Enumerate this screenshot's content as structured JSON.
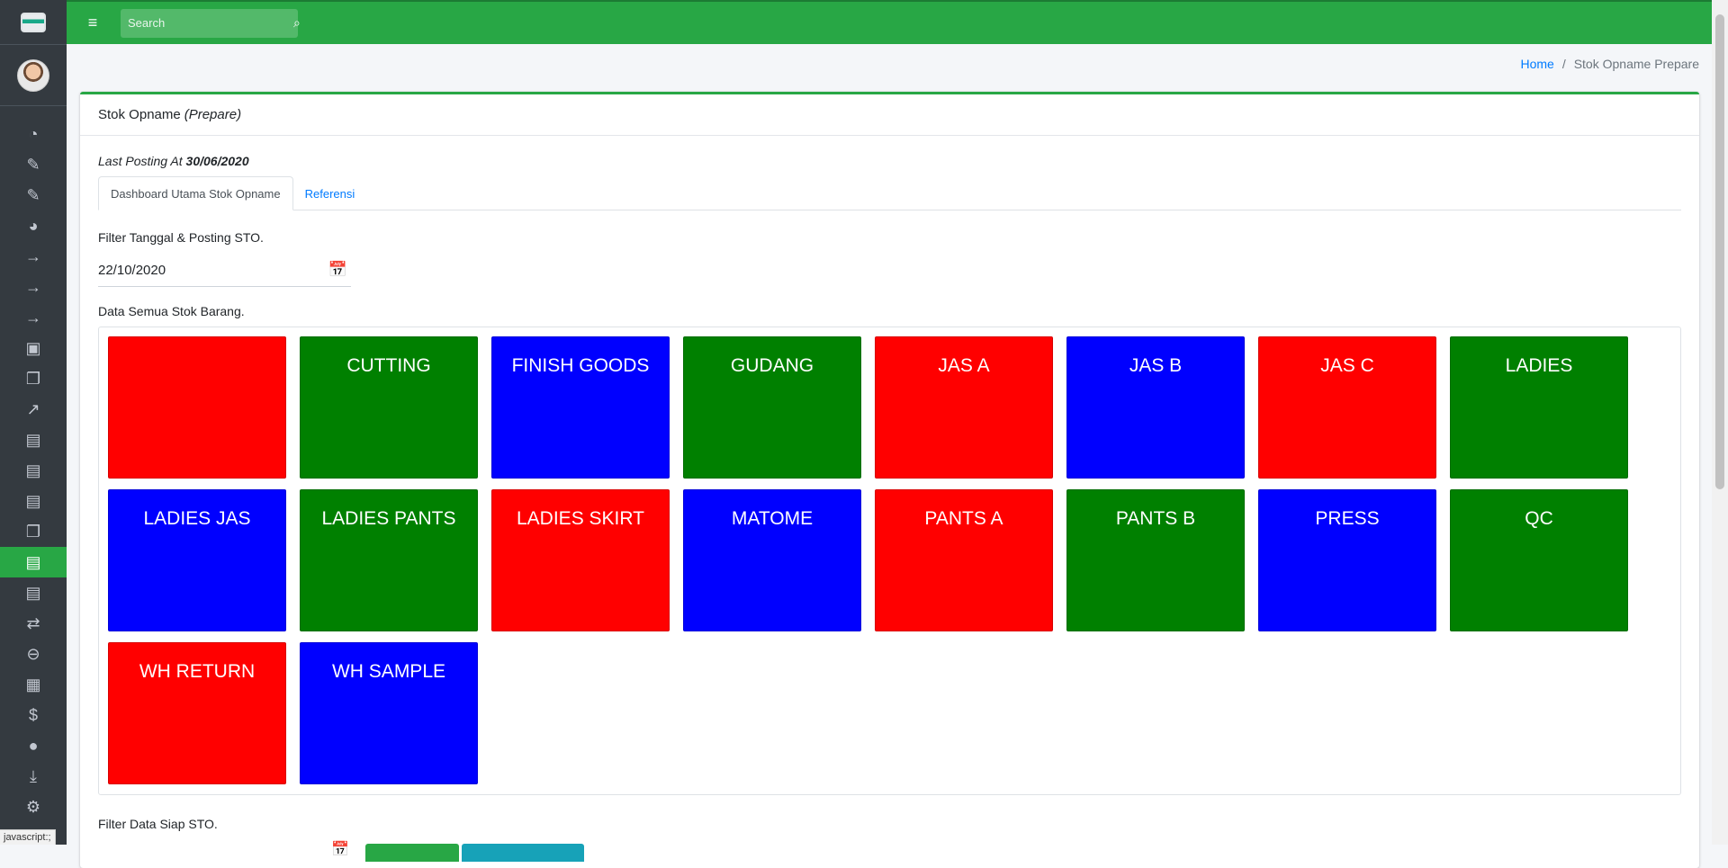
{
  "topbar": {
    "search_placeholder": "Search"
  },
  "breadcrumb": {
    "home": "Home",
    "current": "Stok Opname Prepare"
  },
  "card": {
    "title": "Stok Opname",
    "title_suffix": "(Prepare)",
    "last_posting_label": "Last Posting At",
    "last_posting_date": "30/06/2020",
    "tabs": [
      "Dashboard Utama Stok Opname",
      "Referensi"
    ],
    "filter_label": "Filter Tanggal & Posting STO.",
    "filter_date": "22/10/2020",
    "data_label": "Data Semua Stok Barang.",
    "siap_label": "Filter Data Siap STO."
  },
  "tiles": [
    {
      "label": "",
      "color": "#ff0000"
    },
    {
      "label": "CUTTING",
      "color": "#008000"
    },
    {
      "label": "FINISH GOODS",
      "color": "#0000ff"
    },
    {
      "label": "GUDANG",
      "color": "#008000"
    },
    {
      "label": "JAS A",
      "color": "#ff0000"
    },
    {
      "label": "JAS B",
      "color": "#0000ff"
    },
    {
      "label": "JAS C",
      "color": "#ff0000"
    },
    {
      "label": "LADIES",
      "color": "#008000"
    },
    {
      "label": "LADIES JAS",
      "color": "#0000ff"
    },
    {
      "label": "LADIES PANTS",
      "color": "#008000"
    },
    {
      "label": "LADIES SKIRT",
      "color": "#ff0000"
    },
    {
      "label": "MATOME",
      "color": "#0000ff"
    },
    {
      "label": "PANTS A",
      "color": "#ff0000"
    },
    {
      "label": "PANTS B",
      "color": "#008000"
    },
    {
      "label": "PRESS",
      "color": "#0000ff"
    },
    {
      "label": "QC",
      "color": "#008000"
    },
    {
      "label": "WH RETURN",
      "color": "#ff0000"
    },
    {
      "label": "WH SAMPLE",
      "color": "#0000ff"
    }
  ],
  "sidebar_icons": [
    "dashboard-icon",
    "edit-icon",
    "edit-icon",
    "pie-chart-icon",
    "arrow-right-icon",
    "arrow-right-icon",
    "arrow-right-icon",
    "briefcase-icon",
    "copy-icon",
    "line-chart-icon",
    "warehouse-icon",
    "warehouse-icon",
    "warehouse-icon",
    "copy-icon",
    "warehouse-icon",
    "warehouse-icon",
    "exchange-icon",
    "minus-circle-icon",
    "calculator-icon",
    "dollar-icon",
    "user-icon",
    "download-icon",
    "gear-icon"
  ],
  "status_hint": "javascript:;",
  "colors": {
    "primary": "#28a745",
    "sidebar": "#343a40",
    "link": "#007bff"
  }
}
